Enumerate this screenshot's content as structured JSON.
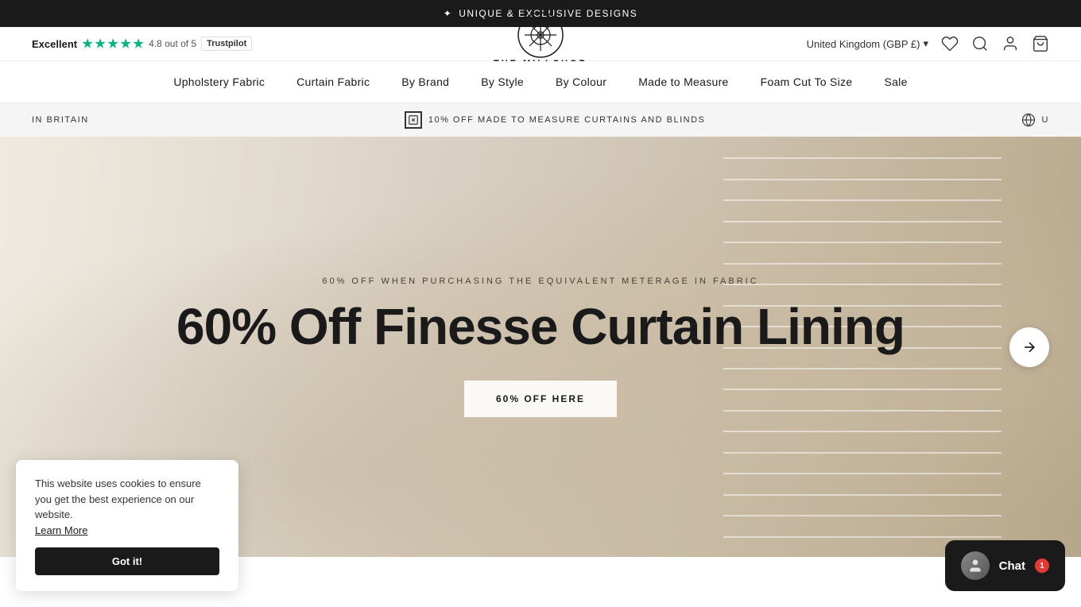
{
  "announcement": {
    "icon": "✦",
    "text": "UNIQUE & EXCLUSIVE DESIGNS"
  },
  "header": {
    "excellent_label": "Excellent",
    "rating": "4.8 out of 5",
    "trustpilot_label": "Trustpilot",
    "logo_line1": "THE MILLSHOP",
    "logo_line2": "ONLINE",
    "region": "United Kingdom (GBP £)",
    "region_chevron": "▾"
  },
  "nav": {
    "items": [
      {
        "id": "upholstery-fabric",
        "label": "Upholstery Fabric"
      },
      {
        "id": "curtain-fabric",
        "label": "Curtain Fabric"
      },
      {
        "id": "by-brand",
        "label": "By Brand"
      },
      {
        "id": "by-style",
        "label": "By Style"
      },
      {
        "id": "by-colour",
        "label": "By Colour"
      },
      {
        "id": "made-to-measure",
        "label": "Made to Measure"
      },
      {
        "id": "foam-cut-to-size",
        "label": "Foam Cut To Size"
      },
      {
        "id": "sale",
        "label": "Sale"
      }
    ]
  },
  "promo_bar": {
    "left_text": "IN BRITAIN",
    "center_icon": "□",
    "center_text": "10% OFF MADE TO MEASURE CURTAINS AND BLINDS",
    "right_icon": "🌐",
    "right_text": "U"
  },
  "hero": {
    "subtitle": "60% OFF WHEN PURCHASING THE EQUIVALENT METERAGE IN FABRIC",
    "title_line1": "60% Off Finesse Curtain Lining",
    "cta_label": "60% OFF HERE",
    "arrow": "→"
  },
  "cookie": {
    "body_text": "This website uses cookies to ensure you get the best experience on our website.",
    "learn_more_label": "Learn More",
    "button_label": "Got it!"
  },
  "chat": {
    "label": "Chat",
    "badge": "1",
    "avatar_emoji": "👤"
  }
}
